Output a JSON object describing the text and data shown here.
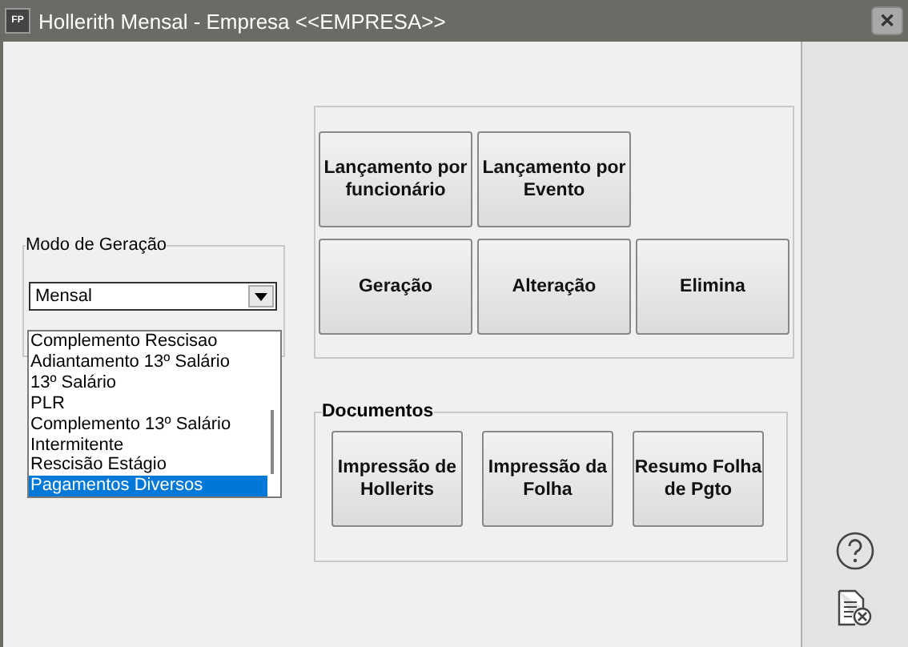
{
  "window": {
    "badge": "FP",
    "title": "Hollerith Mensal - Empresa <<EMPRESA>>",
    "close": "✕"
  },
  "mode": {
    "legend": "Modo de Geração",
    "value": "Mensal",
    "expanded": true,
    "options": [
      {
        "label": "Complemento Rescisao",
        "selected": false
      },
      {
        "label": "Adiantamento 13º Salário",
        "selected": false
      },
      {
        "label": "13º Salário",
        "selected": false
      },
      {
        "label": "PLR",
        "selected": false
      },
      {
        "label": "Complemento 13º Salário",
        "selected": false
      },
      {
        "label": "Intermitente",
        "selected": false
      },
      {
        "label": "Rescisão Estágio",
        "selected": false
      },
      {
        "label": "Pagamentos Diversos",
        "selected": true
      }
    ]
  },
  "actions": {
    "rows": [
      [
        "Lançamento por funcionário",
        "Lançamento por Evento"
      ],
      [
        "Geração",
        "Alteração",
        "Elimina"
      ]
    ]
  },
  "documents": {
    "legend": "Documentos",
    "buttons": [
      "Impressão de Hollerits",
      "Impressão da Folha",
      "Resumo Folha de Pgto"
    ]
  }
}
